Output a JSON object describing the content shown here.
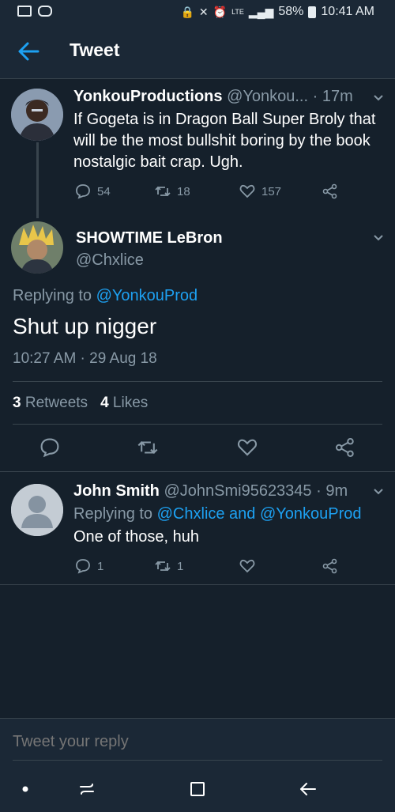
{
  "status_bar": {
    "battery": "58%",
    "time": "10:41 AM",
    "lte": "LTE"
  },
  "header": {
    "title": "Tweet",
    "back_icon": "back-arrow-icon"
  },
  "parent_tweet": {
    "name": "YonkouProductions",
    "handle": "@Yonkou...",
    "time": "· 17m",
    "text": "If Gogeta is in Dragon Ball Super Broly that will be the most bullshit boring by the book nostalgic bait crap. Ugh.",
    "replies": "54",
    "retweets": "18",
    "likes": "157"
  },
  "main_tweet": {
    "name": "SHOWTIME LeBron",
    "handle": "@Chxlice",
    "replying_prefix": "Replying to ",
    "replying_handle": "@YonkouProd",
    "text": "Shut up nigger",
    "timestamp": "10:27 AM · 29 Aug 18",
    "retweet_count": "3",
    "retweet_label": "Retweets",
    "like_count": "4",
    "like_label": "Likes"
  },
  "reply_tweet": {
    "name": "John Smith",
    "handle": "@JohnSmi95623345",
    "time": "· 9m",
    "replying_prefix": "Replying to ",
    "replying_handles": "@Chxlice and @YonkouProd",
    "text": "One of those, huh",
    "replies": "1",
    "retweets": "1"
  },
  "compose": {
    "placeholder": "Tweet your reply"
  },
  "colors": {
    "background": "#15202b",
    "bar": "#1b2836",
    "accent": "#1da1f2",
    "muted": "#8899a6",
    "divider": "#38444d"
  }
}
